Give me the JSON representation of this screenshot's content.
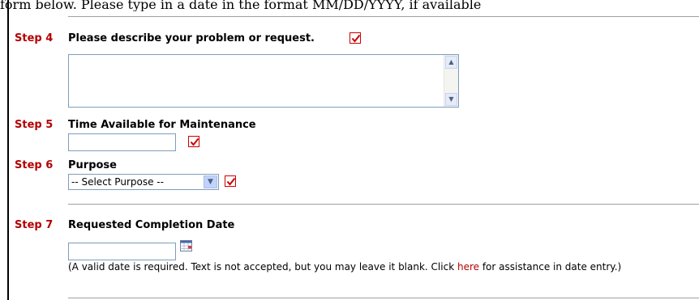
{
  "clipped_header_text": "form below. Please type in a date in the format MM/DD/YYYY, if available",
  "step4": {
    "number": "Step 4",
    "title": "Please describe your problem or request.",
    "required_icon": "checkmark-icon"
  },
  "step5": {
    "number": "Step 5",
    "title": "Time Available for Maintenance",
    "required_icon": "checkmark-icon"
  },
  "step6": {
    "number": "Step 6",
    "title": "Purpose",
    "select_value": "-- Select Purpose --",
    "required_icon": "checkmark-icon"
  },
  "step7": {
    "number": "Step 7",
    "title": "Requested Completion Date",
    "calendar_icon": "calendar-icon",
    "note_before_link": "(A valid date is required. Text is not accepted, but you may leave it blank. Click ",
    "note_link": "here",
    "note_after_link": " for assistance in date entry.)"
  },
  "colors": {
    "step_number": "#b30000",
    "checkmark": "#cc0000",
    "input_border": "#7f9db9",
    "rule": "#a0a0a0"
  }
}
